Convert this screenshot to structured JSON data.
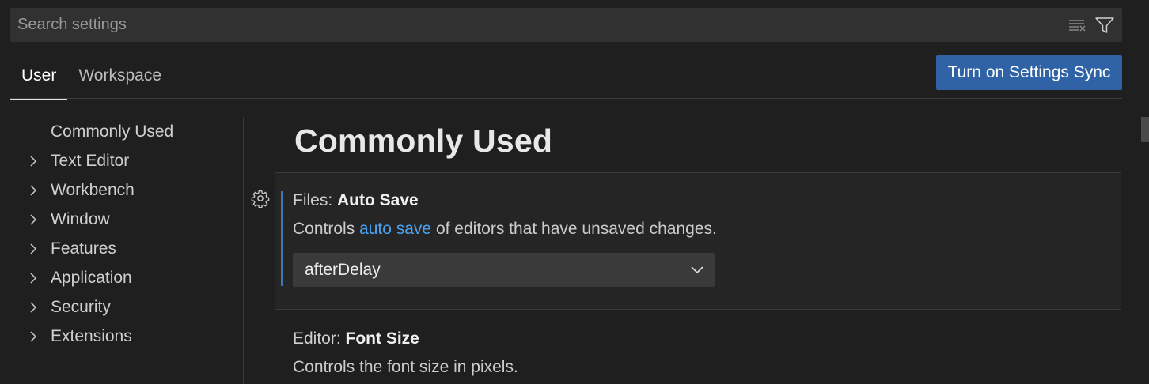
{
  "search": {
    "placeholder": "Search settings"
  },
  "tabs": [
    {
      "label": "User",
      "active": true
    },
    {
      "label": "Workspace",
      "active": false
    }
  ],
  "sync_button": {
    "label": "Turn on Settings Sync"
  },
  "toc": {
    "items": [
      {
        "label": "Commonly Used",
        "expandable": false
      },
      {
        "label": "Text Editor",
        "expandable": true
      },
      {
        "label": "Workbench",
        "expandable": true
      },
      {
        "label": "Window",
        "expandable": true
      },
      {
        "label": "Features",
        "expandable": true
      },
      {
        "label": "Application",
        "expandable": true
      },
      {
        "label": "Security",
        "expandable": true
      },
      {
        "label": "Extensions",
        "expandable": true
      }
    ]
  },
  "main": {
    "section_title": "Commonly Used",
    "settings": [
      {
        "category": "Files: ",
        "name": "Auto Save",
        "desc_before": "Controls ",
        "desc_link": "auto save",
        "desc_after": " of editors that have unsaved changes.",
        "value": "afterDelay"
      },
      {
        "category": "Editor: ",
        "name": "Font Size",
        "desc_before": "Controls the font size in pixels.",
        "desc_link": "",
        "desc_after": ""
      }
    ]
  },
  "colors": {
    "background": "#1f1f1f",
    "accent": "#2f63a6",
    "link": "#4aa3f0",
    "focus_indicator": "#3b78b5"
  }
}
